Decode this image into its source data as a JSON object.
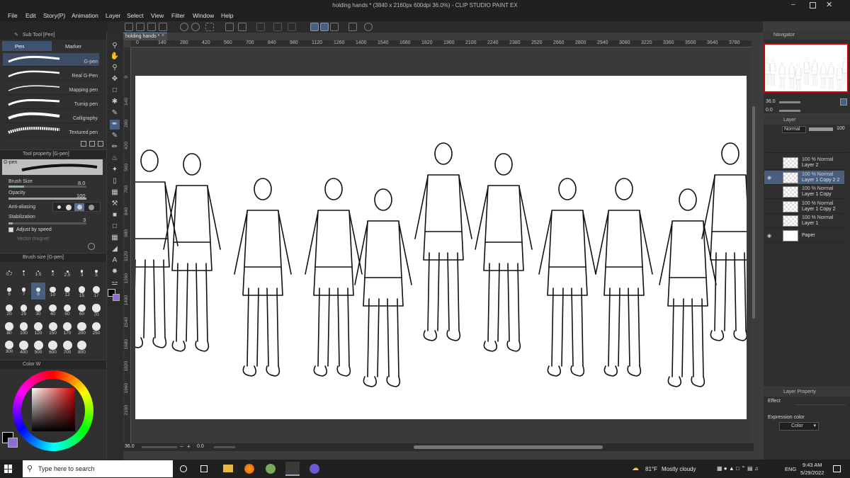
{
  "window": {
    "title": "holding hands * (3840 x 2160px 600dpi 36.0%) - CLIP STUDIO PAINT EX"
  },
  "menu": [
    "File",
    "Edit",
    "Story(P)",
    "Animation",
    "Layer",
    "Select",
    "View",
    "Filter",
    "Window",
    "Help"
  ],
  "subtool": {
    "header": "Sub Tool [Pen]",
    "tabs": [
      "Pen",
      "Marker"
    ],
    "brushes": [
      "G-pen",
      "Real G-Pen",
      "Mapping pen",
      "Turnip pen",
      "Calligraphy",
      "Textured pen"
    ]
  },
  "toolprop": {
    "header": "Tool property [G-pen]",
    "preview_label": "G-pen",
    "brush_size_label": "Brush Size",
    "brush_size_value": "8.0",
    "opacity_label": "Opacity",
    "opacity_value": "100",
    "antialias_label": "Anti-aliasing",
    "stabilization_label": "Stabilization",
    "stabilization_value": "3",
    "adjust_label": "Adjust by speed",
    "vector_label": "Vector magnet"
  },
  "brushsize": {
    "header": "Brush size [G-pen]",
    "sizes": [
      "0.7",
      "1",
      "1.5",
      "2",
      "2.5",
      "3",
      "5",
      "6",
      "7",
      "8",
      "10",
      "12",
      "15",
      "17",
      "20",
      "25",
      "30",
      "40",
      "50",
      "60",
      "70",
      "80",
      "100",
      "120",
      "150",
      "170",
      "200",
      "250",
      "300",
      "400",
      "500",
      "600",
      "700",
      "800"
    ]
  },
  "color": {
    "header": "Color W",
    "main_color": "#000000",
    "accent": "#8a6fd0"
  },
  "canvas": {
    "tab_label": "holding hands *",
    "ruler_top": [
      "0",
      "140",
      "280",
      "420",
      "560",
      "700",
      "840",
      "980",
      "1120",
      "1260",
      "1400",
      "1540",
      "1680",
      "1820",
      "1960",
      "2100",
      "2240",
      "2380",
      "2520",
      "2660",
      "2800",
      "2940",
      "3080",
      "3220",
      "3360",
      "3500",
      "3640",
      "3780"
    ],
    "ruler_left": [
      "0",
      "140",
      "280",
      "420",
      "560",
      "700",
      "840",
      "980",
      "1120",
      "1260",
      "1400",
      "1540",
      "1680",
      "1820",
      "1960",
      "2100"
    ],
    "zoom": "36.0",
    "rotation": "0.0"
  },
  "navigator": {
    "header": "Navigator",
    "zoom": "36.0",
    "rotation": "0.0"
  },
  "layers": {
    "header": "Layer",
    "blend_mode": "Normal",
    "opacity": "100",
    "rows": [
      {
        "mode": "100 % Normal",
        "name": "Layer 2",
        "visible": false,
        "selected": false
      },
      {
        "mode": "100 % Normal",
        "name": "Layer 1 Copy 2 2",
        "visible": true,
        "selected": true
      },
      {
        "mode": "100 % Normal",
        "name": "Layer 1 Copy",
        "visible": false,
        "selected": false
      },
      {
        "mode": "100 % Normal",
        "name": "Layer 1 Copy 2",
        "visible": false,
        "selected": false
      },
      {
        "mode": "100 % Normal",
        "name": "Layer 1",
        "visible": false,
        "selected": false
      },
      {
        "mode": "",
        "name": "Paper",
        "visible": true,
        "selected": false
      }
    ]
  },
  "layerprop": {
    "header": "Layer Property",
    "effect_label": "Effect",
    "expr_label": "Expression color",
    "expr_value": "Color"
  },
  "taskbar": {
    "search_placeholder": "Type here to search",
    "weather_temp": "81°F",
    "weather_text": "Mostly cloudy",
    "lang": "ENG",
    "time": "9:43 AM",
    "date": "5/29/2022"
  }
}
